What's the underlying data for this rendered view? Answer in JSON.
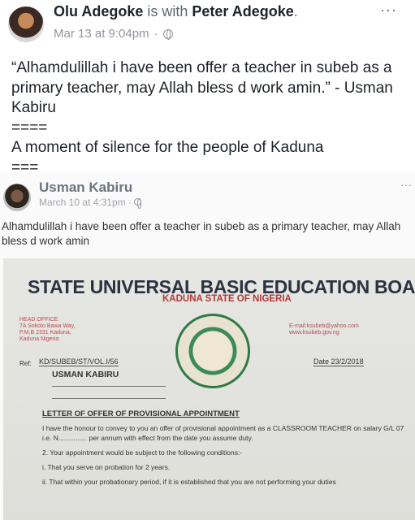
{
  "post": {
    "author": "Olu Adegoke",
    "with_text": " is with ",
    "tagged": "Peter Adegoke",
    "tagged_suffix": ".",
    "timestamp": "Mar 13 at 9:04pm",
    "separator": "·",
    "more": "···",
    "text_lines": [
      "“Alhamdulillah i have been offer a teacher in subeb as a primary teacher, may Allah bless d work amin.” - Usman Kabiru",
      "====",
      "A moment of silence for the people of Kaduna",
      "==="
    ]
  },
  "shared": {
    "author": "Usman Kabiru",
    "timestamp": "March 10 at 4:31pm · ",
    "more": "···",
    "text": "Alhamdulillah i have been offer a teacher in subeb as a primary teacher, may Allah bless d work amin"
  },
  "letter": {
    "title": "STATE UNIVERSAL BASIC EDUCATION BOARD (SUBEB)",
    "subtitle": "KADUNA STATE OF NIGERIA",
    "address_lines": [
      "HEAD OFFICE:",
      "7A Sokoto Bawa Way,",
      "P.M.B 2331 Kaduna,",
      "Kaduna Nigeria"
    ],
    "email_lines": [
      "E-mail:ksubeb@yahoo.com",
      "www.ksubeb.gov.ng"
    ],
    "ref_label": "Ref:",
    "ref_value": "KD/SUBEB/ST/VOL.I/56",
    "date_label": "Date",
    "date_value": "23/2/2018",
    "addressee": "USMAN KABIRU",
    "heading": "LETTER OF OFFER OF PROVISIONAL APPOINTMENT",
    "body": [
      "I have the honour to convey to you an offer of provisional appointment as a CLASSROOM TEACHER on salary G/L 07 i.e. N............... per annum with effect from the date you assume duty.",
      "2. Your appointment would be subject to the following conditions:-",
      "i. That you serve on probation for 2 years.",
      "ii. That within your probationary period, if it is established that you are not performing your duties"
    ]
  }
}
